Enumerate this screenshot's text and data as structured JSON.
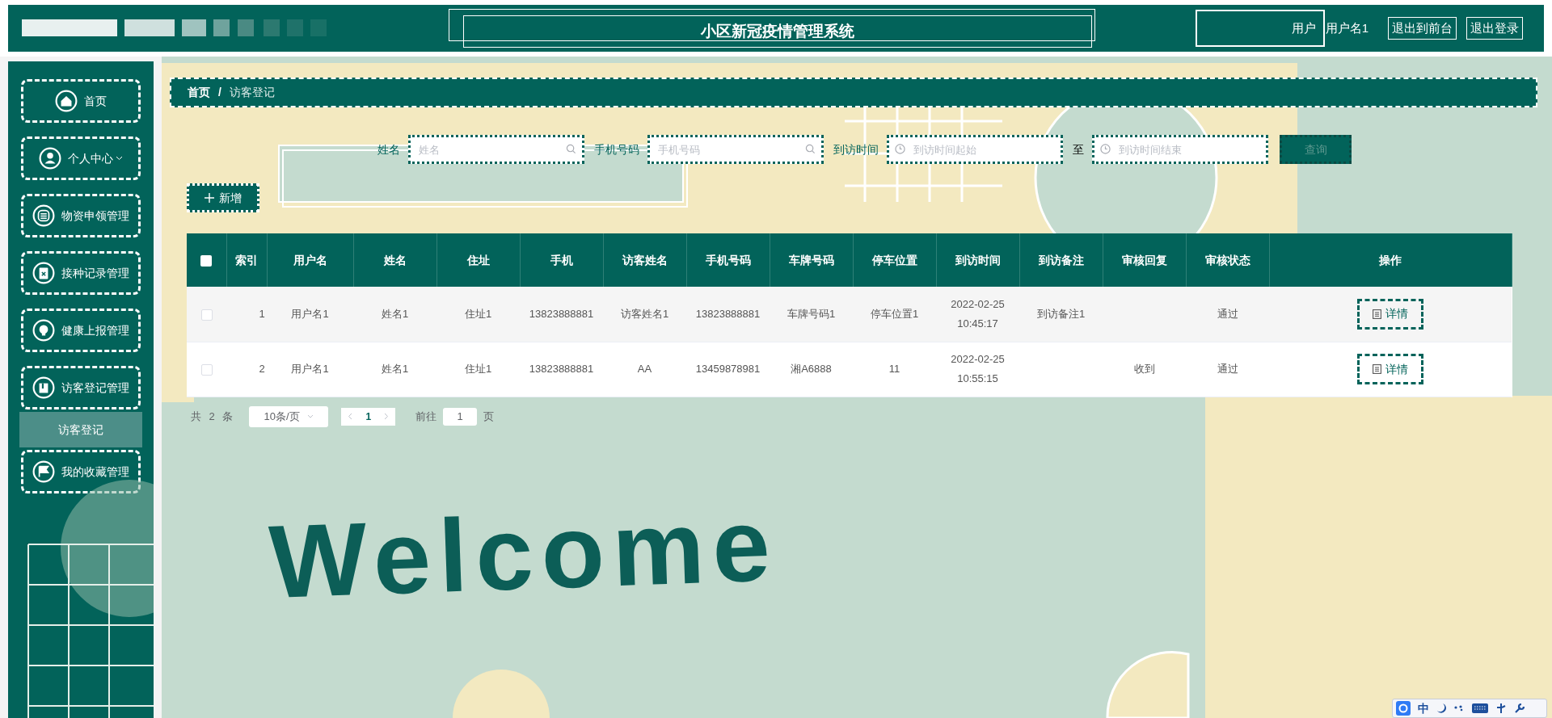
{
  "header": {
    "title": "小区新冠疫情管理系统",
    "role": "用户",
    "username": "用户名1",
    "links": [
      "退出到前台",
      "退出登录"
    ]
  },
  "sidebar": {
    "items": [
      {
        "label": "首页",
        "kind": "home",
        "caret": false
      },
      {
        "label": "个人中心",
        "kind": "user",
        "caret": true
      },
      {
        "label": "物资申领管理",
        "kind": "list",
        "caret": false
      },
      {
        "label": "接种记录管理",
        "kind": "clipboard",
        "caret": false
      },
      {
        "label": "健康上报管理",
        "kind": "bulb",
        "caret": false
      },
      {
        "label": "访客登记管理",
        "kind": "bag",
        "caret": false,
        "children": [
          {
            "label": "访客登记",
            "selected": true
          }
        ]
      },
      {
        "label": "我的收藏管理",
        "kind": "flag",
        "caret": false
      }
    ]
  },
  "breadcrumb": {
    "items": [
      "首页",
      "访客登记"
    ],
    "separator": "/"
  },
  "search": {
    "fields": [
      {
        "label": "姓名",
        "placeholder": "姓名",
        "kind": "text"
      },
      {
        "label": "手机号码",
        "placeholder": "手机号码",
        "kind": "text"
      },
      {
        "label": "到访时间",
        "placeholder": "到访时间起始",
        "kind": "date"
      },
      {
        "label": "至",
        "placeholder": "到访时间结束",
        "kind": "date"
      }
    ],
    "button": "查询"
  },
  "add_button": "新增",
  "table": {
    "header_checked": false,
    "columns": [
      "索引",
      "用户名",
      "姓名",
      "住址",
      "手机",
      "访客姓名",
      "手机号码",
      "车牌号码",
      "停车位置",
      "到访时间",
      "到访备注",
      "审核回复",
      "审核状态",
      "操作"
    ],
    "rows": [
      {
        "checked": false,
        "cells": [
          "1",
          "用户名1",
          "姓名1",
          "住址1",
          "13823888881",
          "访客姓名1",
          "13823888881",
          "车牌号码1",
          "停车位置1",
          "2022-02-25 10:45:17",
          "到访备注1",
          "",
          "通过"
        ],
        "action": "详情"
      },
      {
        "checked": false,
        "cells": [
          "2",
          "用户名1",
          "姓名1",
          "住址1",
          "13823888881",
          "AA",
          "13459878981",
          "湘A6888",
          "11",
          "2022-02-25 10:55:15",
          "",
          "收到",
          "通过"
        ],
        "action": "详情"
      }
    ]
  },
  "pagination": {
    "total": "共 2 条",
    "page_size": "10条/页",
    "pages": [
      {
        "label": "1",
        "selected": true
      }
    ],
    "goto_label": "前往",
    "goto_value": "1",
    "goto_suffix": "页"
  },
  "welcome": "Welcome",
  "ime": {
    "label": "中"
  }
}
